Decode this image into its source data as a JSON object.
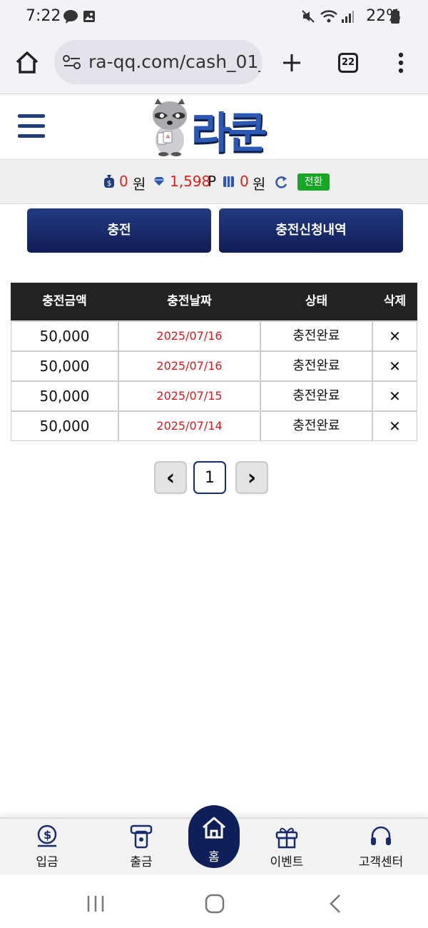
{
  "status_bar": {
    "time": "7:22",
    "battery": "22%"
  },
  "browser": {
    "url": "ra-qq.com/cash_01_",
    "tab_count": "22"
  },
  "site": {
    "logo_text": "라쿤"
  },
  "balance": {
    "cash_value": "0",
    "cash_unit": "원",
    "point_value": "1,598",
    "point_unit": "P",
    "coupon_value": "0",
    "coupon_unit": "원",
    "convert_label": "전환"
  },
  "tabs": {
    "charge": "충전",
    "history": "충전신청내역"
  },
  "table": {
    "headers": [
      "충전금액",
      "충전날짜",
      "상태",
      "삭제"
    ],
    "rows": [
      {
        "amount": "50,000",
        "date": "2025/07/16",
        "status": "충전완료",
        "delete": "✕"
      },
      {
        "amount": "50,000",
        "date": "2025/07/16",
        "status": "충전완료",
        "delete": "✕"
      },
      {
        "amount": "50,000",
        "date": "2025/07/15",
        "status": "충전완료",
        "delete": "✕"
      },
      {
        "amount": "50,000",
        "date": "2025/07/14",
        "status": "충전완료",
        "delete": "✕"
      }
    ]
  },
  "pagination": {
    "prev": "‹",
    "current": "1",
    "next": "›"
  },
  "bottom_nav": {
    "deposit": "입금",
    "withdraw": "출금",
    "home": "홈",
    "event": "이벤트",
    "support": "고객센터"
  },
  "colors": {
    "brand_navy": "#1a2b6c",
    "accent_red": "#e0201c",
    "convert_green": "#19a526"
  }
}
